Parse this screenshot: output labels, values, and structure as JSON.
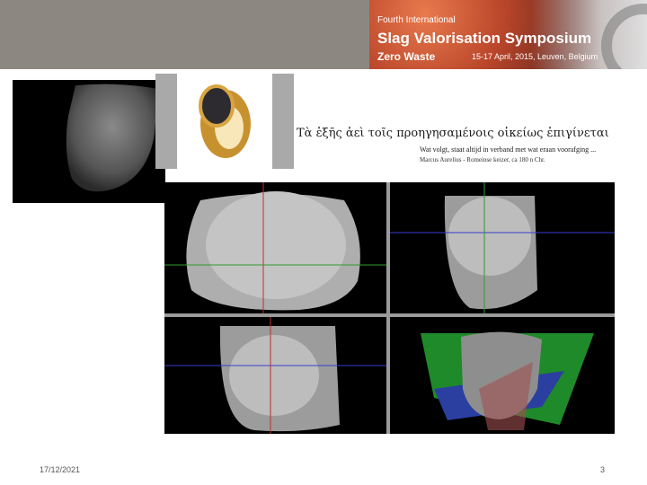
{
  "banner": {
    "line1": "Fourth International",
    "title": "Slag Valorisation Symposium",
    "subtitle": "Zero Waste",
    "dates": "15-17 April, 2015, Leuven, Belgium"
  },
  "quote": {
    "greek": "Τὰ ἑξῆς ἀεὶ τοῖς προηγησαμένοις οἰκείως ἐπιγίνεται",
    "dutch": "Wat volgt, staat altijd in verband met wat eraan voorafging ...",
    "source": "Marcus Aurelius - Romeinse keizer, ca 180 n Chr."
  },
  "footer": {
    "date": "17/12/2021",
    "page": "3"
  }
}
